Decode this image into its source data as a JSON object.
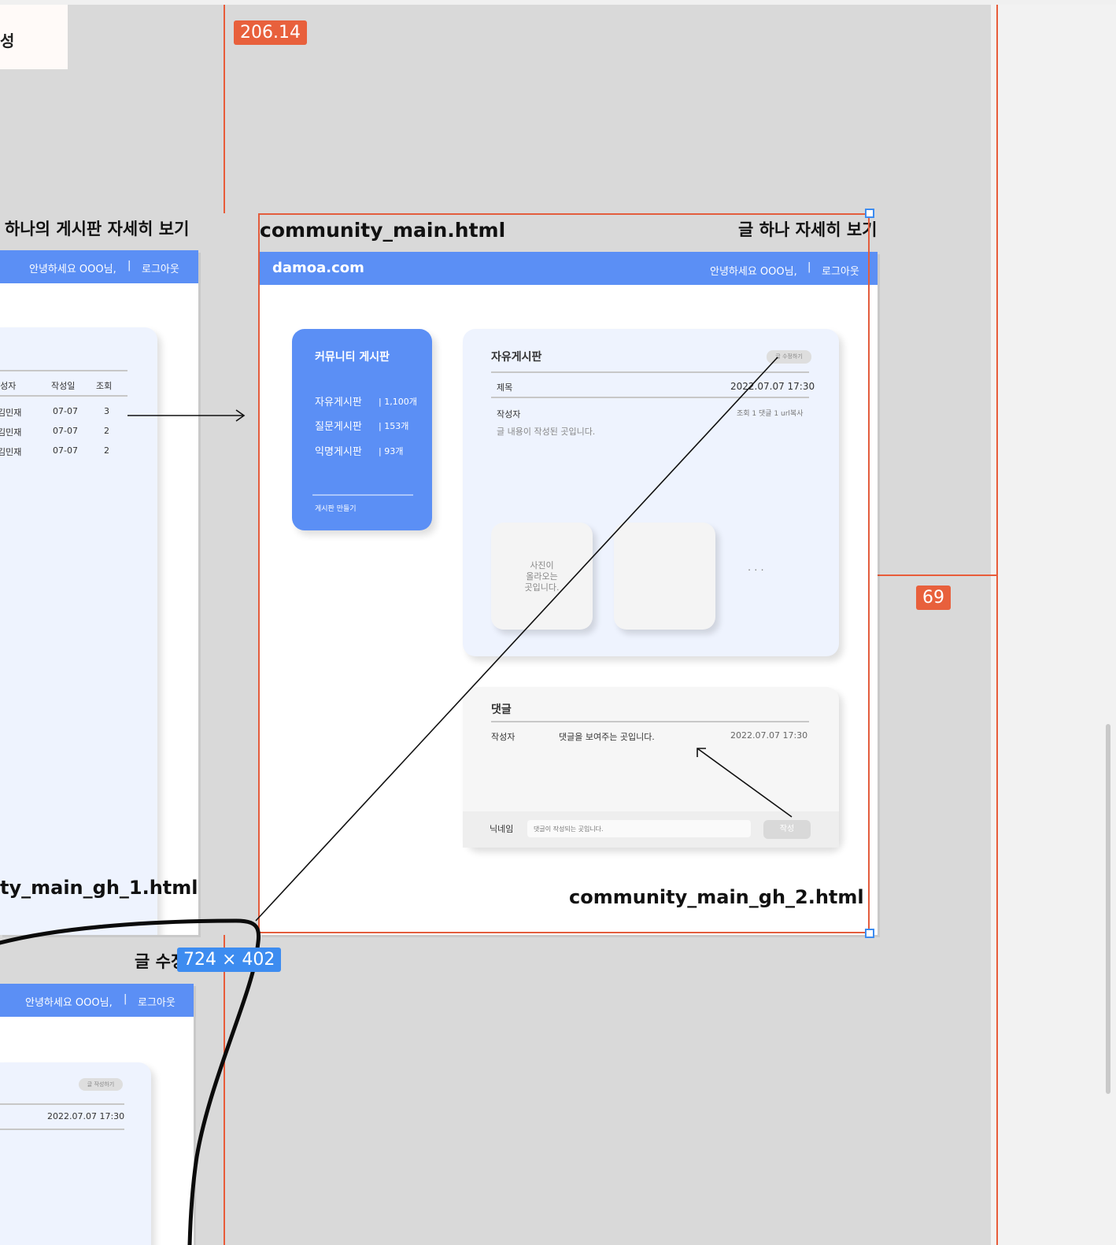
{
  "canvas": {
    "measurement_top": "206.14",
    "measurement_right": "69",
    "selection_dimensions": "724 × 402"
  },
  "frames": {
    "left_top": {
      "partial_label": "성",
      "heading": "하나의 게시판 자세히 보기",
      "greeting": "안녕하세요 OOO님,",
      "separator": "|",
      "logout": "로그아웃",
      "table_headers": [
        "작성자",
        "작성일",
        "조회"
      ],
      "table_rows": [
        {
          "author": "김민재",
          "date": "07-07",
          "views": "3"
        },
        {
          "author": "김민재",
          "date": "07-07",
          "views": "2"
        },
        {
          "author": "김민재",
          "date": "07-07",
          "views": "2"
        }
      ],
      "bottom_label": "ty_main_gh_1.html"
    },
    "left_bottom": {
      "heading_partial": "글 수정",
      "greeting": "안녕하세요 OOO님,",
      "separator": "|",
      "logout": "로그아웃",
      "write_button": "글 작성하기",
      "datetime": "2022.07.07 17:30"
    },
    "main": {
      "file_label": "community_main.html",
      "right_heading": "글 하나 자세히 보기",
      "bottom_label": "community_main_gh_2.html",
      "navbar": {
        "brand": "damoa.com",
        "greeting": "안녕하세요 OOO님,",
        "separator": "|",
        "logout": "로그아웃"
      },
      "sidebar": {
        "title": "커뮤니티 게시판",
        "boards": [
          {
            "name": "자유게시판",
            "count": "| 1,100개"
          },
          {
            "name": "질문게시판",
            "count": "| 153개"
          },
          {
            "name": "익명게시판",
            "count": "| 93개"
          }
        ],
        "create_link": "게시판 만들기"
      },
      "post": {
        "board_title": "자유게시판",
        "edit_button": "글 수정하기",
        "title_label": "제목",
        "datetime": "2022.07.07 17:30",
        "author_label": "작성자",
        "meta": "조회 1  댓글 1  url복사",
        "content": "글 내용이 작성된 곳입니다.",
        "photo_placeholder": "사진이\n올라오는\n곳입니다.",
        "more": "· · ·"
      },
      "comments": {
        "title": "댓글",
        "author": "작성자",
        "text": "댓글을 보여주는 곳입니다.",
        "datetime": "2022.07.07 17:30",
        "nickname_label": "닉네임",
        "input_placeholder": "댓글이 작성되는 곳입니다.",
        "submit": "작성"
      }
    }
  }
}
